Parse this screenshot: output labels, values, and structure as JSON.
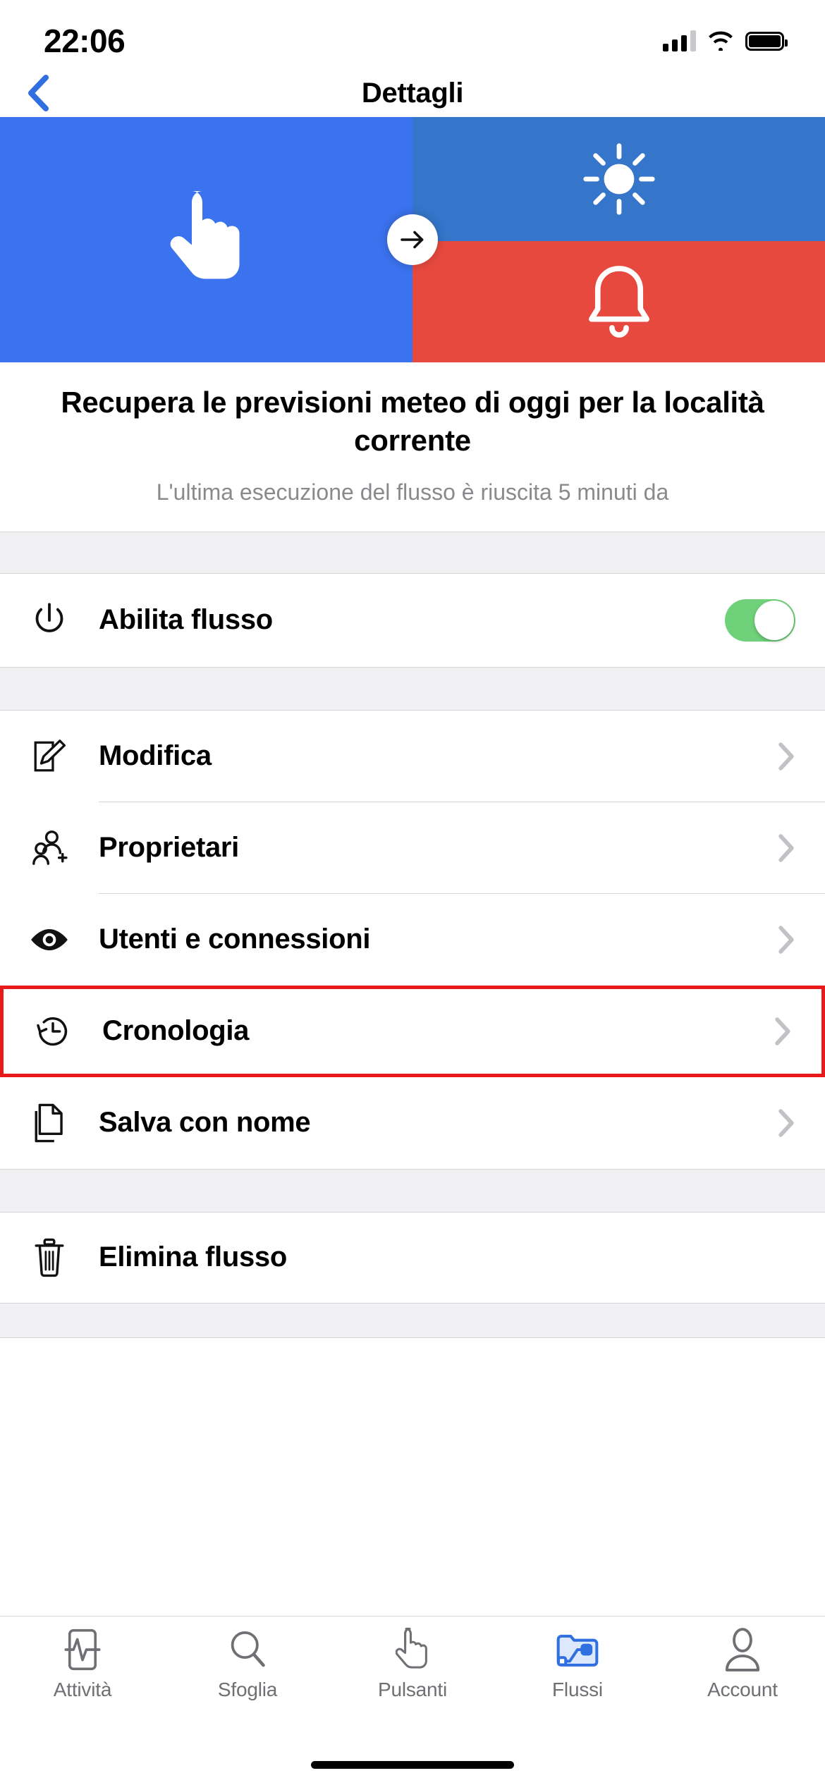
{
  "status_bar": {
    "time": "22:06",
    "signal_icon": "cellular-signal-icon",
    "wifi_icon": "wifi-icon",
    "battery_icon": "battery-full-icon"
  },
  "nav": {
    "back_icon": "chevron-left-icon",
    "title": "Dettagli"
  },
  "hero": {
    "trigger_icon": "finger-tap-icon",
    "arrow_icon": "arrow-right-icon",
    "action_icons": [
      "sun-icon",
      "bell-icon"
    ],
    "colors": {
      "left": "#3b72ee",
      "top_right": "#3576cb",
      "bottom_right": "#e8493f",
      "arrow_circle": "#ffffff"
    }
  },
  "flow": {
    "title": "Recupera le previsioni meteo di oggi per la località corrente",
    "subtitle": "L'ultima esecuzione del flusso è riuscita 5 minuti da"
  },
  "enable_section": {
    "icon": "power-icon",
    "label": "Abilita flusso",
    "toggle_on": true,
    "toggle_color": "#6fd179"
  },
  "menu_items": [
    {
      "icon": "edit-pencil-icon",
      "label": "Modifica",
      "chevron": "chevron-right-icon",
      "highlighted": false
    },
    {
      "icon": "person-add-icon",
      "label": "Proprietari",
      "chevron": "chevron-right-icon",
      "highlighted": false
    },
    {
      "icon": "eye-icon",
      "label": "Utenti e connessioni",
      "chevron": "chevron-right-icon",
      "highlighted": false
    },
    {
      "icon": "history-clock-icon",
      "label": "Cronologia",
      "chevron": "chevron-right-icon",
      "highlighted": true
    },
    {
      "icon": "duplicate-file-icon",
      "label": "Salva con nome",
      "chevron": "chevron-right-icon",
      "highlighted": false
    }
  ],
  "delete_section": {
    "icon": "trash-icon",
    "label": "Elimina flusso"
  },
  "highlight_color": "#e8191b",
  "tabs": [
    {
      "icon": "activity-pulse-icon",
      "label": "Attività",
      "active": false
    },
    {
      "icon": "search-magnifier-icon",
      "label": "Sfoglia",
      "active": false
    },
    {
      "icon": "finger-tap-icon",
      "label": "Pulsanti",
      "active": false
    },
    {
      "icon": "flows-folder-icon",
      "label": "Flussi",
      "active": true
    },
    {
      "icon": "account-person-icon",
      "label": "Account",
      "active": false
    }
  ],
  "tab_active_color": "#2f6fe0",
  "home_indicator": "home-bar"
}
